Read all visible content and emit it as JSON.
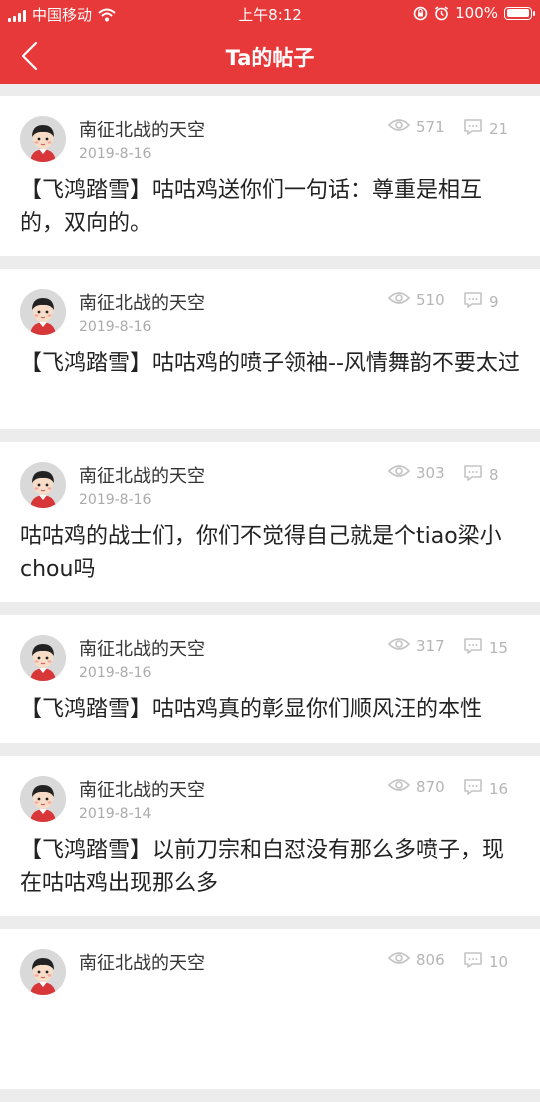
{
  "status_bar": {
    "carrier": "中国移动",
    "time": "上午8:12",
    "battery_percent": "100%",
    "battery_level": 1.0,
    "icons": [
      "signal-icon",
      "wifi-icon",
      "rotation-lock-icon",
      "alarm-icon",
      "battery-icon"
    ]
  },
  "nav": {
    "title": "Ta的帖子",
    "back_icon": "back-arrow-icon",
    "bg_color": "#e8393a"
  },
  "posts": [
    {
      "author": "南征北战的天空",
      "date": "2019-8-16",
      "views": "571",
      "comments": "21",
      "content": "【飞鸿踏雪】咕咕鸡送你们一句话：尊重是相互的，双向的。"
    },
    {
      "author": "南征北战的天空",
      "date": "2019-8-16",
      "views": "510",
      "comments": "9",
      "content": "【飞鸿踏雪】咕咕鸡的喷子领袖--风情舞韵不要太过"
    },
    {
      "author": "南征北战的天空",
      "date": "2019-8-16",
      "views": "303",
      "comments": "8",
      "content": "咕咕鸡的战士们，你们不觉得自己就是个tiao梁小chou吗"
    },
    {
      "author": "南征北战的天空",
      "date": "2019-8-16",
      "views": "317",
      "comments": "15",
      "content": "【飞鸿踏雪】咕咕鸡真的彰显你们顺风汪的本性"
    },
    {
      "author": "南征北战的天空",
      "date": "2019-8-14",
      "views": "870",
      "comments": "16",
      "content": "【飞鸿踏雪】以前刀宗和白怼没有那么多喷子，现在咕咕鸡出现那么多"
    },
    {
      "author": "南征北战的天空",
      "date": "",
      "views": "806",
      "comments": "10",
      "content": ""
    }
  ]
}
